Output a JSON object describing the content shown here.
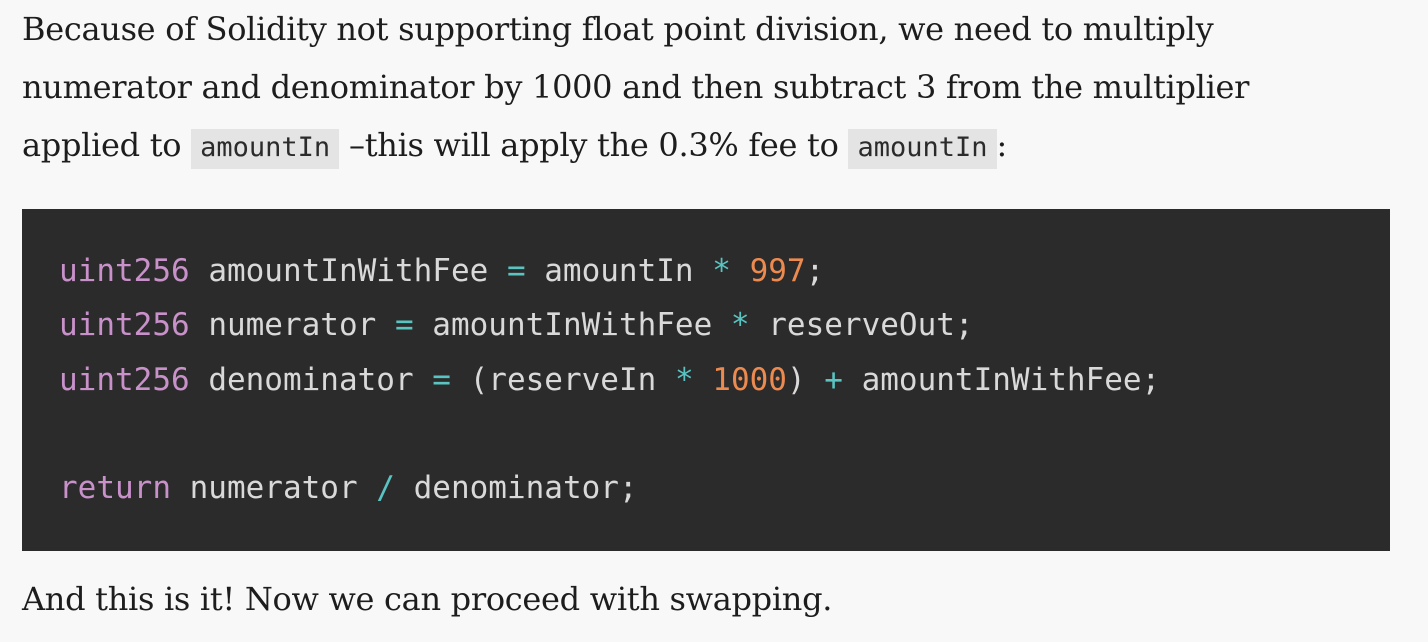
{
  "intro": {
    "line1": "Because of Solidity not supporting float point division, we need to multiply",
    "line2": "numerator and denominator by 1000 and then subtract 3 from the multiplier",
    "line3_a": "applied to ",
    "line3_code1": "amountIn",
    "line3_b": " –this will apply the 0.3% fee to ",
    "line3_code2": "amountIn",
    "line3_c": ":"
  },
  "code": {
    "l1": {
      "type": "uint256",
      "name": " amountInWithFee ",
      "eq": "=",
      "a": " amountIn ",
      "op": "*",
      "sp": " ",
      "num": "997",
      "end": ";"
    },
    "l2": {
      "type": "uint256",
      "name": " numerator ",
      "eq": "=",
      "a": " amountInWithFee ",
      "op": "*",
      "b": " reserveOut;"
    },
    "l3": {
      "type": "uint256",
      "name": " denominator ",
      "eq": "=",
      "a": " (reserveIn ",
      "op": "*",
      "sp": " ",
      "num": "1000",
      "b": ") ",
      "plus": "+",
      "c": " amountInWithFee;"
    },
    "l5": {
      "kw": "return",
      "a": " numerator ",
      "op": "/",
      "b": " denominator;"
    }
  },
  "outro": {
    "text": "And this is it! Now we can proceed with swapping."
  }
}
